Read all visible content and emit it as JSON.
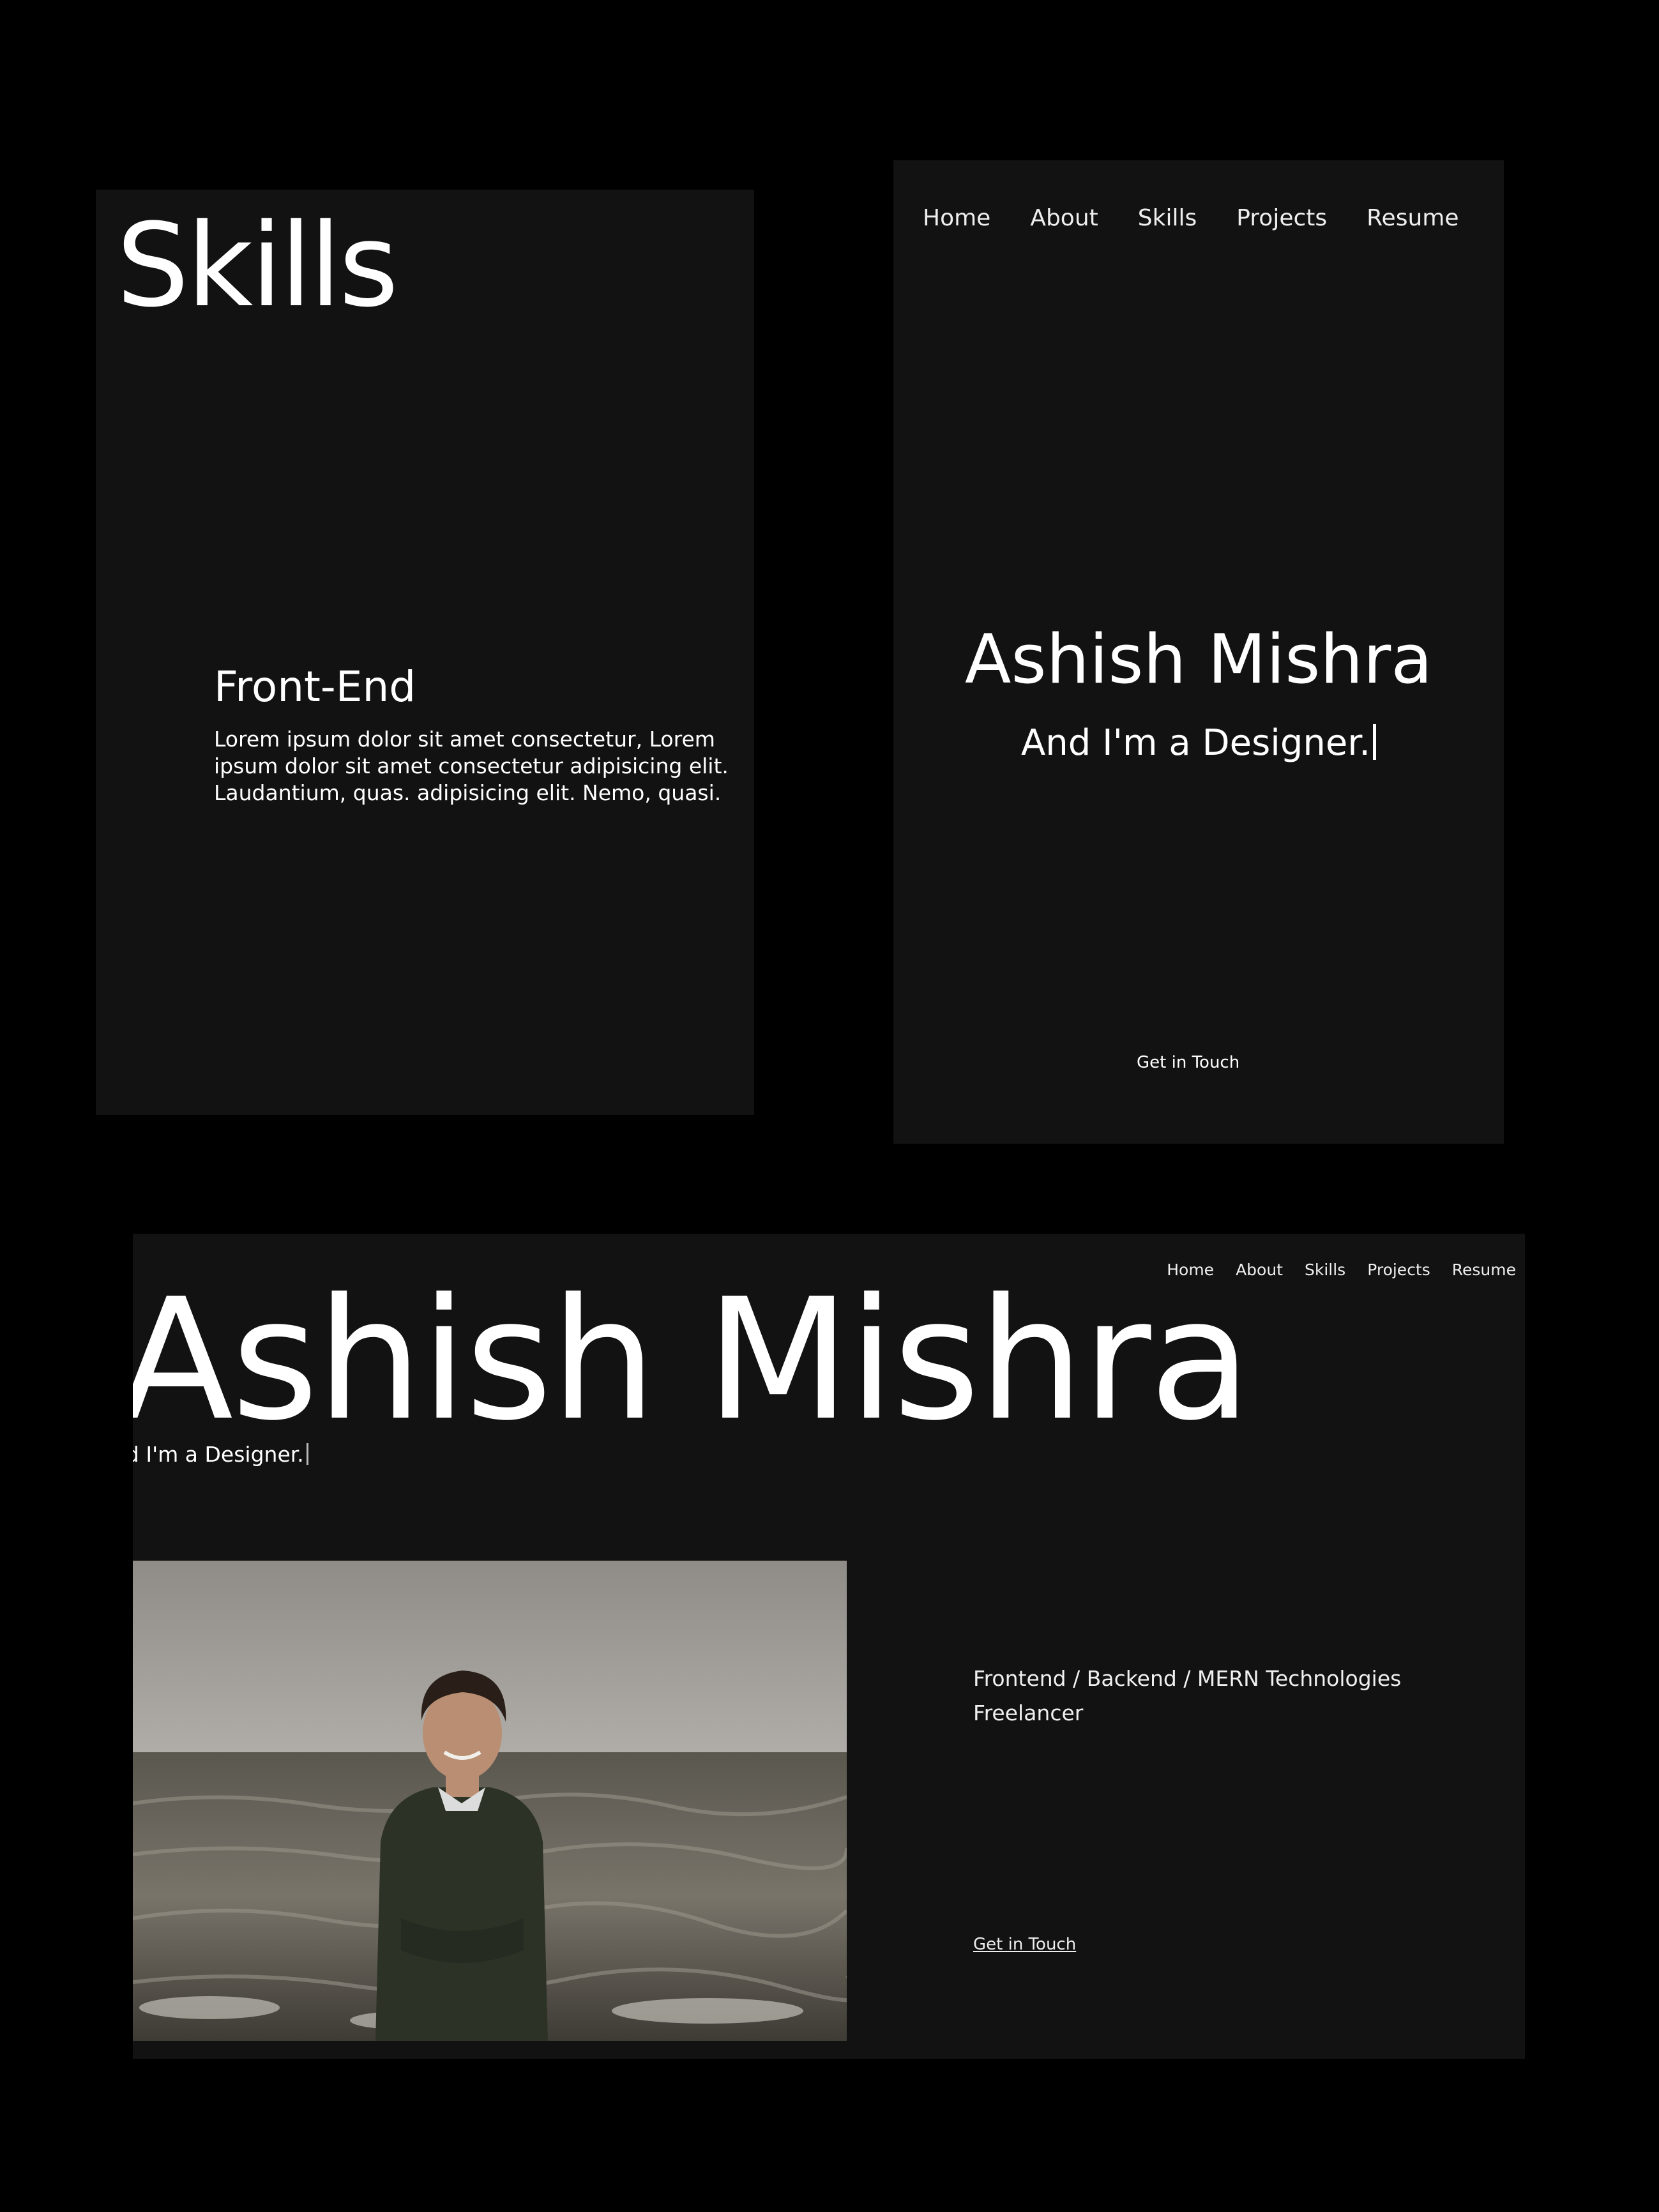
{
  "skills_panel": {
    "title": "Skills",
    "section_title": "Front-End",
    "description": "Lorem ipsum dolor sit amet consectetur, Lorem ipsum dolor sit amet consectetur adipisicing elit. Laudantium, quas. adipisicing elit. Nemo, quasi."
  },
  "mobile_view": {
    "nav": [
      "Home",
      "About",
      "Skills",
      "Projects",
      "Resume"
    ],
    "name": "Ashish Mishra",
    "tagline": "And I'm a Designer.",
    "cta": "Get in Touch"
  },
  "desktop_view": {
    "nav": [
      "Home",
      "About",
      "Skills",
      "Projects",
      "Resume"
    ],
    "name": "Ashish Mishra",
    "tagline": "nd I'm a Designer.",
    "roles": [
      "Frontend / Backend / MERN Technologies",
      "Freelancer"
    ],
    "cta": "Get in Touch"
  },
  "colors": {
    "page_background": "#000000",
    "panel_background": "#121212",
    "text": "#ffffff"
  }
}
